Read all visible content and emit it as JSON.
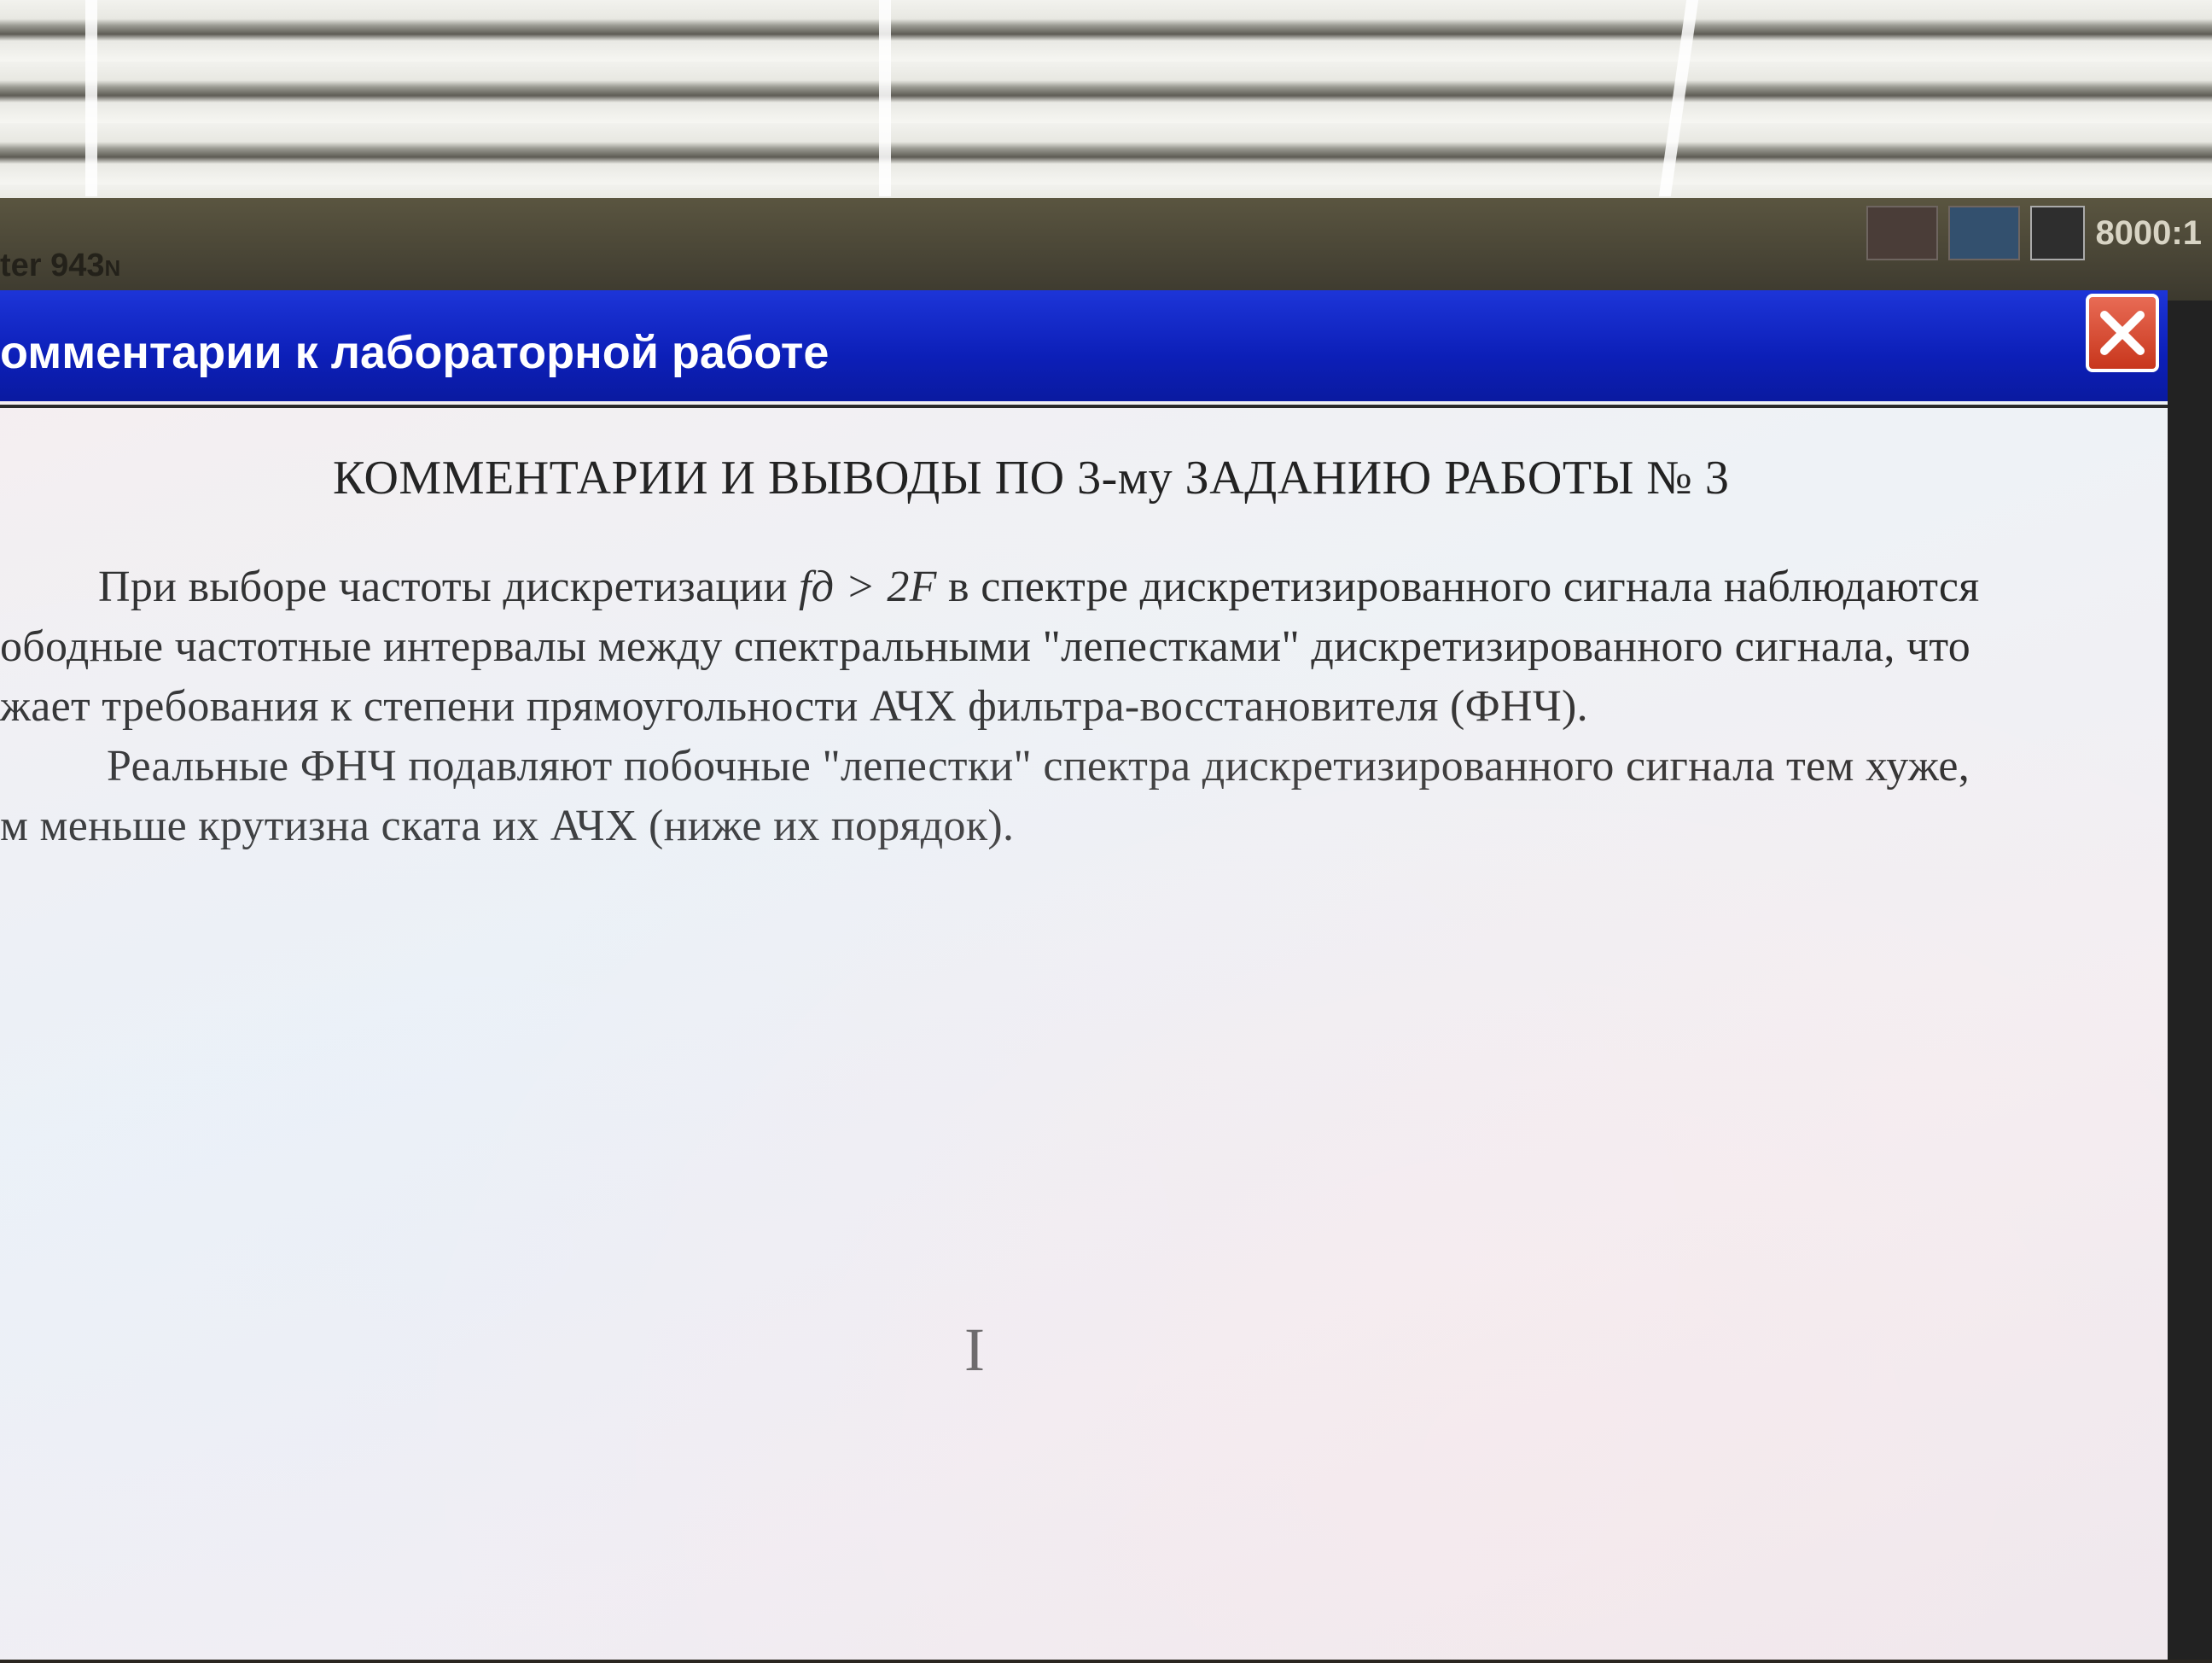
{
  "monitor": {
    "brand_fragment": "ter 943",
    "brand_suffix": "N",
    "contrast_badge": "8000:1"
  },
  "window": {
    "title": "омментарии к лабораторной работе",
    "close_icon": "close-x-icon"
  },
  "document": {
    "heading": "КОММЕНТАРИИ И ВЫВОДЫ ПО 3-му  ЗАДАНИЮ РАБОТЫ № 3",
    "p1_line1_start": "При выборе частоты дискретизации",
    "p1_formula": "fд  > 2F",
    "p1_line1_end": "в спектре дискретизированного сигнала наблюдаются",
    "p1_line2": "ободные частотные интервалы между спектральными \"лепестками\" дискретизированного сигнала, что",
    "p1_line3": "жает требования к степени прямоугольности АЧХ фильтра-восстановителя (ФНЧ).",
    "p2_line1": "Реальные ФНЧ подавляют побочные \"лепестки\" спектра дискретизированного сигнала тем хуже,",
    "p2_line2": "м меньше крутизна ската их АЧХ (ниже их порядок)."
  },
  "cursor": {
    "icon": "text-cursor-icon"
  },
  "colors": {
    "titlebar": "#0c1fb8",
    "close_button": "#c8361c",
    "screen_bg": "#f3eef2"
  }
}
